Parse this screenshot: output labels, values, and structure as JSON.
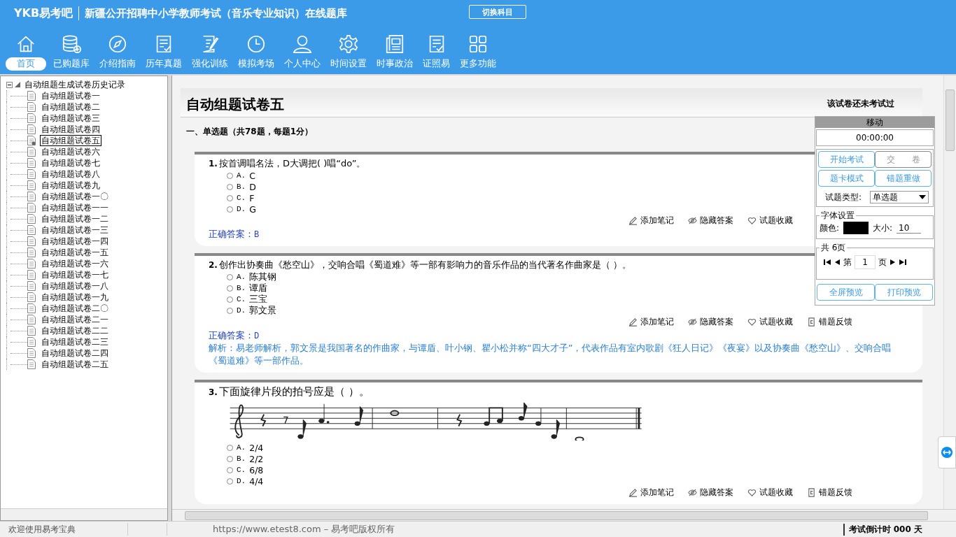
{
  "header": {
    "logo": "YKB易考吧",
    "title": "新疆公开招聘中小学教师考试（音乐专业知识）在线题库",
    "switch_button": "切换科目"
  },
  "toolbar": [
    {
      "kind": "home",
      "label": "首页",
      "selected": true
    },
    {
      "kind": "database",
      "label": "已购题库",
      "selected": false
    },
    {
      "kind": "compass",
      "label": "介绍指南",
      "selected": false
    },
    {
      "kind": "list",
      "label": "历年真题",
      "selected": false
    },
    {
      "kind": "edit",
      "label": "强化训练",
      "selected": false
    },
    {
      "kind": "clock",
      "label": "模拟考场",
      "selected": false
    },
    {
      "kind": "user",
      "label": "个人中心",
      "selected": false
    },
    {
      "kind": "gear",
      "label": "时间设置",
      "selected": false
    },
    {
      "kind": "news",
      "label": "时事政治",
      "selected": false
    },
    {
      "kind": "check",
      "label": "证照易",
      "selected": false
    },
    {
      "kind": "grid",
      "label": "更多功能",
      "selected": false
    }
  ],
  "tree": {
    "label": "自动组题生成试卷历史记录",
    "expanded": true,
    "children": [
      {
        "label": "自动组题试卷一",
        "selected": false
      },
      {
        "label": "自动组题试卷二",
        "selected": false
      },
      {
        "label": "自动组题试卷三",
        "selected": false
      },
      {
        "label": "自动组题试卷四",
        "selected": false
      },
      {
        "label": "自动组题试卷五",
        "selected": true
      },
      {
        "label": "自动组题试卷六",
        "selected": false
      },
      {
        "label": "自动组题试卷七",
        "selected": false
      },
      {
        "label": "自动组题试卷八",
        "selected": false
      },
      {
        "label": "自动组题试卷九",
        "selected": false
      },
      {
        "label": "自动组题试卷一〇",
        "selected": false
      },
      {
        "label": "自动组题试卷一一",
        "selected": false
      },
      {
        "label": "自动组题试卷一二",
        "selected": false
      },
      {
        "label": "自动组题试卷一三",
        "selected": false
      },
      {
        "label": "自动组题试卷一四",
        "selected": false
      },
      {
        "label": "自动组题试卷一五",
        "selected": false
      },
      {
        "label": "自动组题试卷一六",
        "selected": false
      },
      {
        "label": "自动组题试卷一七",
        "selected": false
      },
      {
        "label": "自动组题试卷一八",
        "selected": false
      },
      {
        "label": "自动组题试卷一九",
        "selected": false
      },
      {
        "label": "自动组题试卷二〇",
        "selected": false
      },
      {
        "label": "自动组题试卷二一",
        "selected": false
      },
      {
        "label": "自动组题试卷二二",
        "selected": false
      },
      {
        "label": "自动组题试卷二三",
        "selected": false
      },
      {
        "label": "自动组题试卷二四",
        "selected": false
      },
      {
        "label": "自动组题试卷二五",
        "selected": false
      }
    ]
  },
  "paper": {
    "title": "自动组题试卷五",
    "status": "该试卷还未考试过",
    "section": "一、单选题（共78题，每题1分）",
    "questions": [
      {
        "kind": "text",
        "number": "1.",
        "text": "按首调唱名法，D大调把( )唱“do”。",
        "options": [
          {
            "letter": "A.",
            "text": "C",
            "selected": false
          },
          {
            "letter": "B.",
            "text": "D",
            "selected": false
          },
          {
            "letter": "C.",
            "text": "F",
            "selected": false
          },
          {
            "letter": "D.",
            "text": "G",
            "selected": false
          }
        ],
        "actions": [
          "添加笔记",
          "隐藏答案",
          "试题收藏"
        ],
        "answer_label": "正确答案：",
        "answer": "B"
      },
      {
        "kind": "text",
        "number": "2.",
        "text": "创作出协奏曲《愁空山》，交响合唱《蜀道难》等一部有影响力的音乐作品的当代著名作曲家是（ ）。",
        "options": [
          {
            "letter": "A.",
            "text": "陈其钢",
            "selected": false
          },
          {
            "letter": "B.",
            "text": "谭盾",
            "selected": false
          },
          {
            "letter": "C.",
            "text": "三宝",
            "selected": false
          },
          {
            "letter": "D.",
            "text": "郭文景",
            "selected": false
          }
        ],
        "actions": [
          "添加笔记",
          "隐藏答案",
          "试题收藏",
          "错题反馈"
        ],
        "answer_label": "正确答案：",
        "answer": "D",
        "explanation": "解析：易老师解析，郭文景是我国著名的作曲家，与谭盾、叶小钢、瞿小松并称“四大才子”，代表作品有室内歌剧《狂人日记》《夜宴》以及协奏曲《愁空山》、交响合唱《蜀道难》等一部作品。"
      },
      {
        "kind": "music",
        "number": "3.",
        "text": "下面旋律片段的拍号应是（ ）。",
        "options": [
          {
            "letter": "A.",
            "text": "2/4",
            "selected": false
          },
          {
            "letter": "B.",
            "text": "2/2",
            "selected": false
          },
          {
            "letter": "C.",
            "text": "6/8",
            "selected": false
          },
          {
            "letter": "D.",
            "text": "4/4",
            "selected": false
          }
        ],
        "actions": [
          "添加笔记",
          "隐藏答案",
          "试题收藏",
          "错题反馈"
        ]
      }
    ]
  },
  "panel": {
    "title": "移动",
    "timer": "00:00:00",
    "buttons": [
      {
        "label": "开始考试",
        "disabled": false
      },
      {
        "label": "交　　卷",
        "disabled": true
      },
      {
        "label": "题卡模式",
        "disabled": false
      },
      {
        "label": "错题重做",
        "disabled": false
      }
    ],
    "type_label": "试题类型:",
    "type_value": "单选题",
    "font_group": "字体设置",
    "color_label": "颜色:",
    "size_label": "大小:",
    "size_value": "10",
    "pages_group": "共 6页",
    "page_prefix": "第",
    "page_value": "1",
    "page_suffix": "页",
    "preview_buttons": [
      "全屏预览",
      "打印预览"
    ]
  },
  "status_bar": {
    "welcome": "欢迎使用易考宝典",
    "copyright": "https://www.etest8.com – 易考吧版权所有",
    "countdown": "考试倒计时 000 天"
  }
}
